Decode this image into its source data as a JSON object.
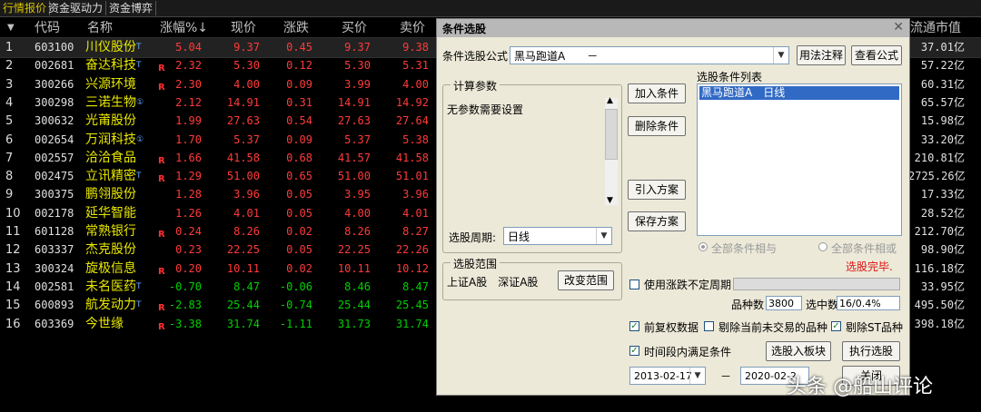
{
  "tabs": [
    "行情报价",
    "资金驱动力",
    "资金博弈"
  ],
  "headers": {
    "arrow": "▼",
    "code": "代码",
    "name": "名称",
    "pct": "涨幅%↓",
    "price": "现价",
    "chg": "涨跌",
    "buy": "买价",
    "sell": "卖价",
    "mcap": "流通市值"
  },
  "rows": [
    {
      "idx": "1",
      "code": "603100",
      "name": "川仪股份",
      "sup": "T",
      "mark": "",
      "pct": "5.04",
      "price": "9.37",
      "chg": "0.45",
      "buy": "9.37",
      "sell": "9.38",
      "mcap": "37.01亿",
      "dir": "up"
    },
    {
      "idx": "2",
      "code": "002681",
      "name": "奋达科技",
      "sup": "T",
      "mark": "R",
      "pct": "2.32",
      "price": "5.30",
      "chg": "0.12",
      "buy": "5.30",
      "sell": "5.31",
      "mcap": "57.22亿",
      "dir": "up"
    },
    {
      "idx": "3",
      "code": "300266",
      "name": "兴源环境",
      "sup": "",
      "mark": "R",
      "pct": "2.30",
      "price": "4.00",
      "chg": "0.09",
      "buy": "3.99",
      "sell": "4.00",
      "mcap": "60.31亿",
      "dir": "up"
    },
    {
      "idx": "4",
      "code": "300298",
      "name": "三诺生物",
      "sup": "①",
      "mark": "",
      "pct": "2.12",
      "price": "14.91",
      "chg": "0.31",
      "buy": "14.91",
      "sell": "14.92",
      "mcap": "65.57亿",
      "dir": "up"
    },
    {
      "idx": "5",
      "code": "300632",
      "name": "光莆股份",
      "sup": "",
      "mark": "",
      "pct": "1.99",
      "price": "27.63",
      "chg": "0.54",
      "buy": "27.63",
      "sell": "27.64",
      "mcap": "15.98亿",
      "dir": "up"
    },
    {
      "idx": "6",
      "code": "002654",
      "name": "万润科技",
      "sup": "①",
      "mark": "",
      "pct": "1.70",
      "price": "5.37",
      "chg": "0.09",
      "buy": "5.37",
      "sell": "5.38",
      "mcap": "33.20亿",
      "dir": "up"
    },
    {
      "idx": "7",
      "code": "002557",
      "name": "洽洽食品",
      "sup": "",
      "mark": "R",
      "pct": "1.66",
      "price": "41.58",
      "chg": "0.68",
      "buy": "41.57",
      "sell": "41.58",
      "mcap": "210.81亿",
      "dir": "up"
    },
    {
      "idx": "8",
      "code": "002475",
      "name": "立讯精密",
      "sup": "T",
      "mark": "R",
      "pct": "1.29",
      "price": "51.00",
      "chg": "0.65",
      "buy": "51.00",
      "sell": "51.01",
      "mcap": "2725.26亿",
      "dir": "up"
    },
    {
      "idx": "9",
      "code": "300375",
      "name": "鹏翎股份",
      "sup": "",
      "mark": "",
      "pct": "1.28",
      "price": "3.96",
      "chg": "0.05",
      "buy": "3.95",
      "sell": "3.96",
      "mcap": "17.33亿",
      "dir": "up"
    },
    {
      "idx": "10",
      "code": "002178",
      "name": "延华智能",
      "sup": "",
      "mark": "",
      "pct": "1.26",
      "price": "4.01",
      "chg": "0.05",
      "buy": "4.00",
      "sell": "4.01",
      "mcap": "28.52亿",
      "dir": "up"
    },
    {
      "idx": "11",
      "code": "601128",
      "name": "常熟银行",
      "sup": "",
      "mark": "R",
      "pct": "0.24",
      "price": "8.26",
      "chg": "0.02",
      "buy": "8.26",
      "sell": "8.27",
      "mcap": "212.70亿",
      "dir": "up"
    },
    {
      "idx": "12",
      "code": "603337",
      "name": "杰克股份",
      "sup": "",
      "mark": "",
      "pct": "0.23",
      "price": "22.25",
      "chg": "0.05",
      "buy": "22.25",
      "sell": "22.26",
      "mcap": "98.90亿",
      "dir": "up"
    },
    {
      "idx": "13",
      "code": "300324",
      "name": "旋极信息",
      "sup": "",
      "mark": "R",
      "pct": "0.20",
      "price": "10.11",
      "chg": "0.02",
      "buy": "10.11",
      "sell": "10.12",
      "mcap": "116.18亿",
      "dir": "up"
    },
    {
      "idx": "14",
      "code": "002581",
      "name": "未名医药",
      "sup": "T",
      "mark": "",
      "pct": "-0.70",
      "price": "8.47",
      "chg": "-0.06",
      "buy": "8.46",
      "sell": "8.47",
      "mcap": "33.95亿",
      "dir": "down"
    },
    {
      "idx": "15",
      "code": "600893",
      "name": "航发动力",
      "sup": "T",
      "mark": "R",
      "pct": "-2.83",
      "price": "25.44",
      "chg": "-0.74",
      "buy": "25.44",
      "sell": "25.45",
      "mcap": "495.50亿",
      "dir": "down"
    },
    {
      "idx": "16",
      "code": "603369",
      "name": "今世缘",
      "sup": "",
      "mark": "R",
      "pct": "-3.38",
      "price": "31.74",
      "chg": "-1.11",
      "buy": "31.73",
      "sell": "31.74",
      "mcap": "398.18亿",
      "dir": "down"
    }
  ],
  "dialog": {
    "title": "条件选股",
    "close": "✕",
    "formula_label": "条件选股公式",
    "formula_value": "黑马跑道A　　－",
    "btn_usage": "用法注释",
    "btn_view": "查看公式",
    "params_group": "计算参数",
    "params_text": "无参数需要设置",
    "period_label": "选股周期:",
    "period_value": "日线",
    "btn_add": "加入条件",
    "btn_delete": "删除条件",
    "btn_import": "引入方案",
    "btn_save": "保存方案",
    "list_label": "选股条件列表",
    "list_items": [
      "黑马跑道A　日线"
    ],
    "radio_and": "全部条件相与",
    "radio_or": "全部条件相或",
    "status": "选股完毕.",
    "range_group": "选股范围",
    "range_text": "上证A股　深证A股",
    "btn_change_range": "改变范围",
    "use_indef_period": "使用涨跌不定周期",
    "count_label": "品种数",
    "count_value": "3800",
    "selected_label": "选中数",
    "selected_value": "16/0.4%",
    "chk_fq": "前复权数据",
    "chk_exclude_untraded": "剔除当前未交易的品种",
    "chk_exclude_st": "剔除ST品种",
    "chk_time_range": "时间段内满足条件",
    "btn_to_block": "选股入板块",
    "btn_run": "执行选股",
    "date_from": "2013-02-17",
    "date_sep": "－",
    "date_to": "2020-02-2",
    "btn_close": "关闭"
  },
  "watermark": "头条 @船山评论"
}
